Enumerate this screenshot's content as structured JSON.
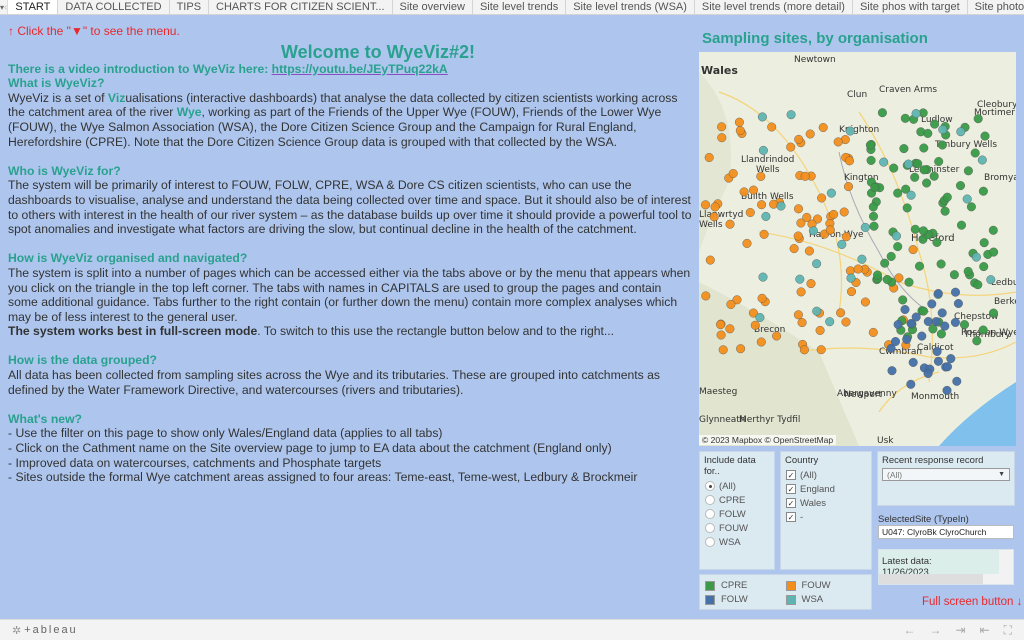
{
  "tabbar": {
    "menu_icon": "▾",
    "prev_icon": "‹",
    "next_icon": "›",
    "tabs": [
      {
        "label": "START",
        "active": true
      },
      {
        "label": "DATA COLLECTED"
      },
      {
        "label": "TIPS"
      },
      {
        "label": "CHARTS FOR CITIZEN SCIENT..."
      },
      {
        "label": "Site overview"
      },
      {
        "label": "Site level trends"
      },
      {
        "label": "Site level trends (WSA)"
      },
      {
        "label": "Site level trends (more detail)"
      },
      {
        "label": "Site phos with target"
      },
      {
        "label": "Site photos and comments"
      }
    ]
  },
  "intro": {
    "menu_hint": "↑ Click the \"▼\" to see the menu.",
    "welcome": "Welcome to WyeViz#2!",
    "video_prefix": "There is a video introduction to WyeViz here: ",
    "video_link": "https://youtu.be/JEyTPuq22kA",
    "what_heading": "What is WyeViz?",
    "what_p1": "WyeViz is a set of ",
    "what_viz": "Viz",
    "what_p2": "ualisations (interactive dashboards) that analyse the data collected by citizen scientists working across the catchment area of the river ",
    "what_wye": "Wye",
    "what_p3": ", working as part of the Friends of the Upper Wye (FOUW), Friends of the Lower Wye (FOUW), the Wye Salmon Association (WSA), the Dore Citizen Science Group and the Campaign for Rural England, Herefordshire (CPRE). Note that the Dore Citizen Science Group data is grouped with that collected by the WSA.",
    "who_heading": "Who is WyeViz for?",
    "who_text": "The system will be primarily of interest to FOUW, FOLW, CPRE, WSA & Dore CS citizen scientists, who can use the dashboards to visualise, analyse and understand the data being collected over time and space. But it should also be of interest to others with interest in the health of our river system – as the database builds up over time it should provide a powerful tool to spot anomalies and investigate what factors are driving the slow, but continual decline in the health of the catchment.",
    "how_heading": "How is WyeViz organised and navigated?",
    "how_text": "The system is split into a number of pages which can be accessed either via the tabs above or by the menu that appears when you click on the triangle in the top left corner. The tabs with names in CAPITALS are used to group the pages and contain some additional guidance. Tabs further to the right contain (or further down the menu) contain more complex analyses which may be of less interest to the general user.",
    "how_bold": "The system works best in full-screen mode",
    "how_tail": ". To switch to this use the rectangle button below and to the right...",
    "grouped_heading": "How is the data grouped?",
    "grouped_text": "All data has been collected from sampling sites across the Wye and its tributaries. These are grouped into catchments as defined by the Water Framework Directive, and watercourses (rivers and tributaries).",
    "new_heading": "What's new?",
    "new_items": [
      "- Use the filter on this page to show only Wales/England data (applies to all tabs)",
      "- Click on the Cathment name on the Site overview page to jump to EA data about the catchment (England only)",
      "- Improved data on watercourses, catchments and Phosphate targets",
      "- Sites outside the formal Wye catchment areas assigned to four areas: Teme-east, Teme-west, Ledbury & Brockmeir"
    ]
  },
  "map": {
    "title": "Sampling sites, by organisation",
    "credit": "© 2023 Mapbox  © OpenStreetMap",
    "places": [
      "Wales",
      "Newtown",
      "Clun",
      "Craven Arms",
      "Cleobury",
      "Mortimer",
      "Ludlow",
      "Knighton",
      "Tenbury Wells",
      "Llandrindod",
      "Wells",
      "Builth Wells",
      "Llanwrtyd",
      "Wells",
      "Kington",
      "Leominster",
      "Bromyard",
      "Hay-on-Wye",
      "Hereford",
      "Ledbury",
      "Brecon",
      "Ross-on-Wye",
      "Abergavenny",
      "Monmouth",
      "Merthyr Tydfil",
      "Glynneath",
      "Usk",
      "Cwmbran",
      "Chepstow",
      "Berkeley",
      "Thornbury",
      "Newport",
      "Caldicot",
      "Maesteg"
    ]
  },
  "filters": {
    "org_title": "Include data for..",
    "org_options": [
      {
        "label": "(All)",
        "selected": true
      },
      {
        "label": "CPRE",
        "selected": false
      },
      {
        "label": "FOLW",
        "selected": false
      },
      {
        "label": "FOUW",
        "selected": false
      },
      {
        "label": "WSA",
        "selected": false
      }
    ],
    "country_title": "Country",
    "country_options": [
      {
        "label": "(All)",
        "checked": true
      },
      {
        "label": "England",
        "checked": true
      },
      {
        "label": "Wales",
        "checked": true
      },
      {
        "label": "-",
        "checked": true
      }
    ],
    "recent_title": "Recent response record",
    "recent_value": "(All)",
    "typein_label": "SelectedSite (TypeIn)",
    "typein_value": "U047: ClyroBk ClyroChurch",
    "latest_label": "Latest data:",
    "latest_value": "11/26/2023"
  },
  "legend": [
    {
      "label": "CPRE",
      "color": "#3a9a48"
    },
    {
      "label": "FOUW",
      "color": "#f28e1c"
    },
    {
      "label": "FOLW",
      "color": "#4570a8"
    },
    {
      "label": "WSA",
      "color": "#5fb4b2"
    }
  ],
  "fullscreen_hint": "Full screen button ↓",
  "toolbar": {
    "logo": "+ableau",
    "undo_icon": "←",
    "redo_icon": "→",
    "share_icon": "⇥",
    "revert_icon": "⇤",
    "fullscreen_icon": "⛶"
  }
}
